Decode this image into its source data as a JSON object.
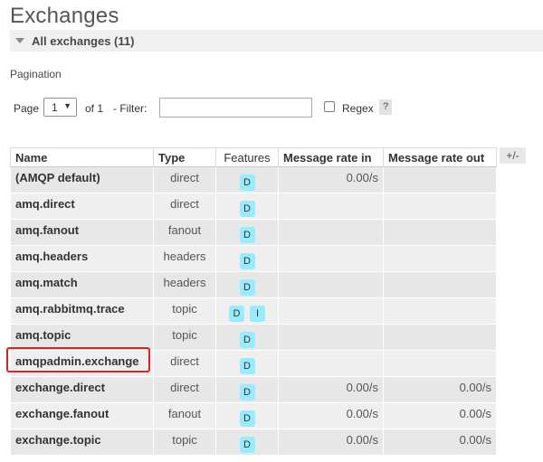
{
  "page": {
    "title": "Exchanges"
  },
  "section": {
    "label": "All exchanges (11)"
  },
  "pagination": {
    "label": "Pagination",
    "page_label": "Page",
    "page_value": "1",
    "of_label": "of 1",
    "filter_label": "- Filter:",
    "filter_value": "",
    "regex_label": "Regex",
    "help_label": "?"
  },
  "table": {
    "columns": [
      "Name",
      "Type",
      "Features",
      "Message rate in",
      "Message rate out"
    ],
    "toggle_columns_label": "+/-",
    "rows": [
      {
        "name": "(AMQP default)",
        "type": "direct",
        "features": [
          "D"
        ],
        "rate_in": "0.00/s",
        "rate_out": ""
      },
      {
        "name": "amq.direct",
        "type": "direct",
        "features": [
          "D"
        ],
        "rate_in": "",
        "rate_out": ""
      },
      {
        "name": "amq.fanout",
        "type": "fanout",
        "features": [
          "D"
        ],
        "rate_in": "",
        "rate_out": ""
      },
      {
        "name": "amq.headers",
        "type": "headers",
        "features": [
          "D"
        ],
        "rate_in": "",
        "rate_out": ""
      },
      {
        "name": "amq.match",
        "type": "headers",
        "features": [
          "D"
        ],
        "rate_in": "",
        "rate_out": ""
      },
      {
        "name": "amq.rabbitmq.trace",
        "type": "topic",
        "features": [
          "D",
          "I"
        ],
        "rate_in": "",
        "rate_out": ""
      },
      {
        "name": "amq.topic",
        "type": "topic",
        "features": [
          "D"
        ],
        "rate_in": "",
        "rate_out": ""
      },
      {
        "name": "amqpadmin.exchange",
        "type": "direct",
        "features": [
          "D"
        ],
        "rate_in": "",
        "rate_out": ""
      },
      {
        "name": "exchange.direct",
        "type": "direct",
        "features": [
          "D"
        ],
        "rate_in": "0.00/s",
        "rate_out": "0.00/s"
      },
      {
        "name": "exchange.fanout",
        "type": "fanout",
        "features": [
          "D"
        ],
        "rate_in": "0.00/s",
        "rate_out": "0.00/s"
      },
      {
        "name": "exchange.topic",
        "type": "topic",
        "features": [
          "D"
        ],
        "rate_in": "0.00/s",
        "rate_out": "0.00/s"
      }
    ]
  },
  "colors": {
    "badge": "#99ebff",
    "highlight": "#e02020",
    "row_odd": "#e7e7e7",
    "row_even": "#efefef"
  },
  "icons": {
    "collapse": "triangle-down-icon"
  }
}
